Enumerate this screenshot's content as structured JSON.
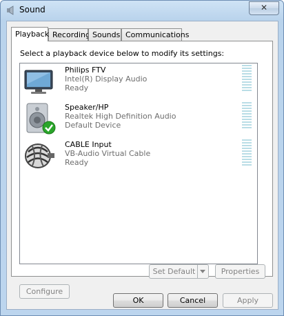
{
  "window": {
    "title": "Sound",
    "close_glyph": "✕"
  },
  "tabs": [
    {
      "label": "Playback",
      "active": true
    },
    {
      "label": "Recording",
      "active": false
    },
    {
      "label": "Sounds",
      "active": false
    },
    {
      "label": "Communications",
      "active": false
    }
  ],
  "instruction": "Select a playback device below to modify its settings:",
  "devices": [
    {
      "name": "Philips FTV",
      "driver": "Intel(R) Display Audio",
      "status": "Ready",
      "icon": "monitor-icon",
      "default": false
    },
    {
      "name": "Speaker/HP",
      "driver": "Realtek High Definition Audio",
      "status": "Default Device",
      "icon": "speaker-icon",
      "default": true
    },
    {
      "name": "CABLE Input",
      "driver": "VB-Audio Virtual Cable",
      "status": "Ready",
      "icon": "cable-icon",
      "default": false
    }
  ],
  "buttons": {
    "configure": "Configure",
    "set_default": "Set Default",
    "properties": "Properties",
    "ok": "OK",
    "cancel": "Cancel",
    "apply": "Apply"
  },
  "colors": {
    "accent_check": "#2aa52a",
    "meter": "#b9dde6"
  }
}
